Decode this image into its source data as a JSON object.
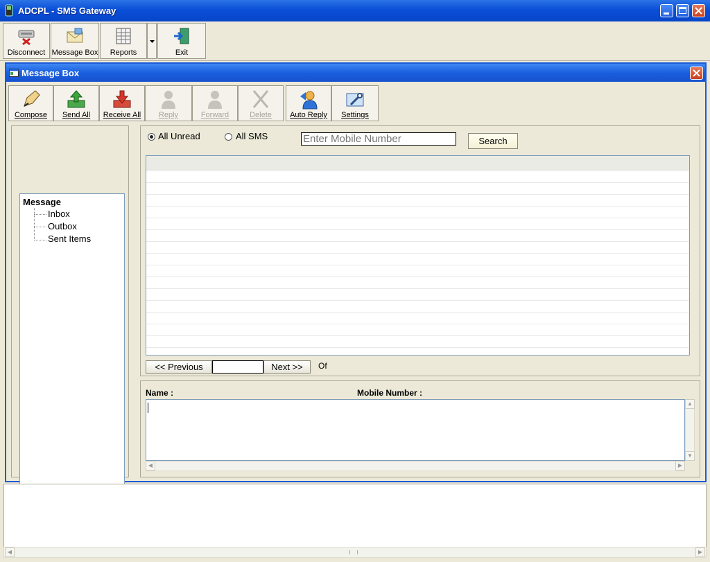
{
  "app": {
    "title": "ADCPL - SMS Gateway",
    "accent": "#0a4fd8"
  },
  "main_toolbar": {
    "disconnect": "Disconnect",
    "message_box": "Message Box",
    "reports": "Reports",
    "exit": "Exit"
  },
  "window": {
    "title": "Message Box"
  },
  "msg_toolbar": {
    "compose": "Compose",
    "send_all": "Send All",
    "receive_all": "Receive All",
    "reply": "Reply",
    "forward": "Forward",
    "delete": "Delete",
    "auto_reply": "Auto Reply",
    "settings": "Settings"
  },
  "tree": {
    "root": "Message",
    "items": [
      "Inbox",
      "Outbox",
      "Sent Items"
    ]
  },
  "filter": {
    "all_unread": "All Unread",
    "all_sms": "All SMS",
    "mobile_placeholder": "Enter Mobile Number",
    "search": "Search"
  },
  "pager": {
    "previous": "<< Previous",
    "next": "Next >>",
    "of": "Of",
    "page_value": ""
  },
  "detail": {
    "name_label": "Name :",
    "mobile_label": "Mobile Number :"
  }
}
